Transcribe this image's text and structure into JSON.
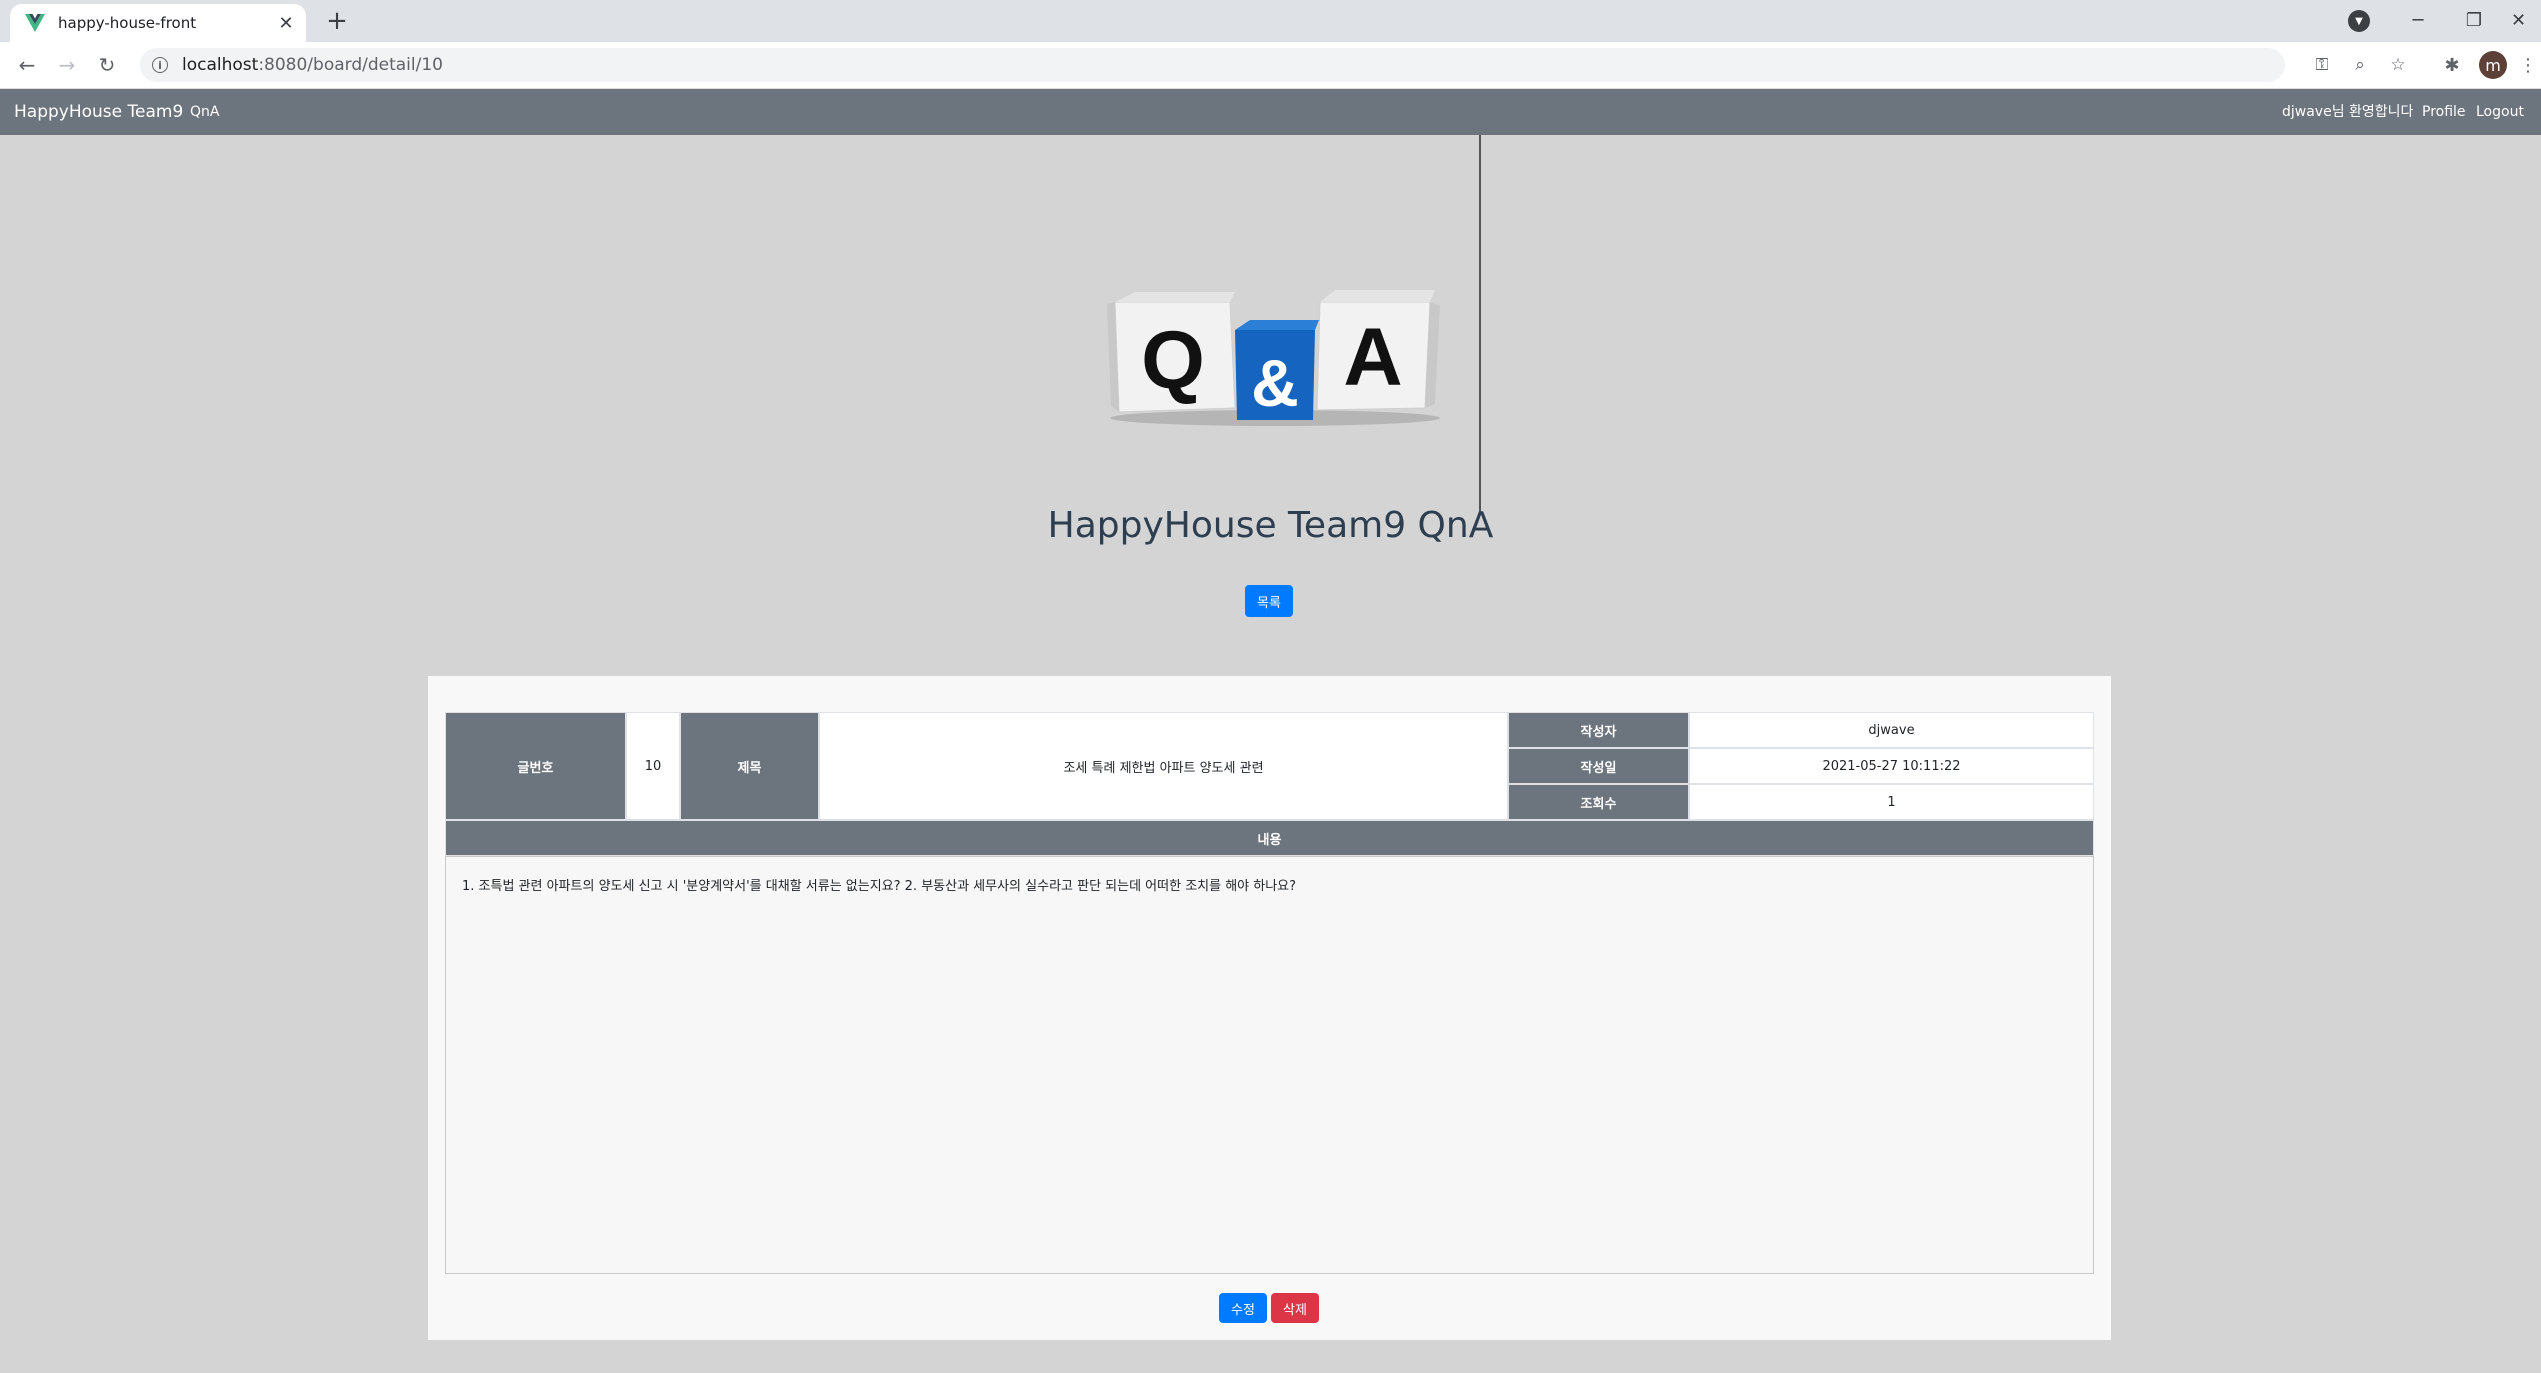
{
  "browser": {
    "tab_title": "happy-house-front",
    "url_host": "localhost",
    "url_path": ":8080/board/detail/10",
    "profile_initial": "m"
  },
  "nav": {
    "brand": "HappyHouse Team9",
    "qna_link": "QnA",
    "welcome": "djwave님 환영합니다",
    "profile": "Profile",
    "logout": "Logout"
  },
  "hero": {
    "title": "HappyHouse Team9 QnA",
    "list_button": "목록",
    "logo_letters": [
      "Q",
      "&",
      "A"
    ]
  },
  "article": {
    "labels": {
      "no": "글번호",
      "title": "제목",
      "author": "작성자",
      "date": "작성일",
      "views": "조회수",
      "content": "내용"
    },
    "no": "10",
    "title": "조세 특례 제한법 아파트 양도세 관련",
    "author": "djwave",
    "date": "2021-05-27 10:11:22",
    "views": "1",
    "content": "1. 조특법 관련 아파트의 양도세 신고 시 '분양계약서'를 대채할 서류는 없는지요? 2. 부동산과 세무사의 실수라고 판단 되는데 어떠한 조치를 해야 하나요?"
  },
  "actions": {
    "edit": "수정",
    "delete": "삭제"
  },
  "colors": {
    "navbar": "#6c757d",
    "primary": "#007bff",
    "danger": "#dc3545",
    "background": "#d4d4d4"
  }
}
